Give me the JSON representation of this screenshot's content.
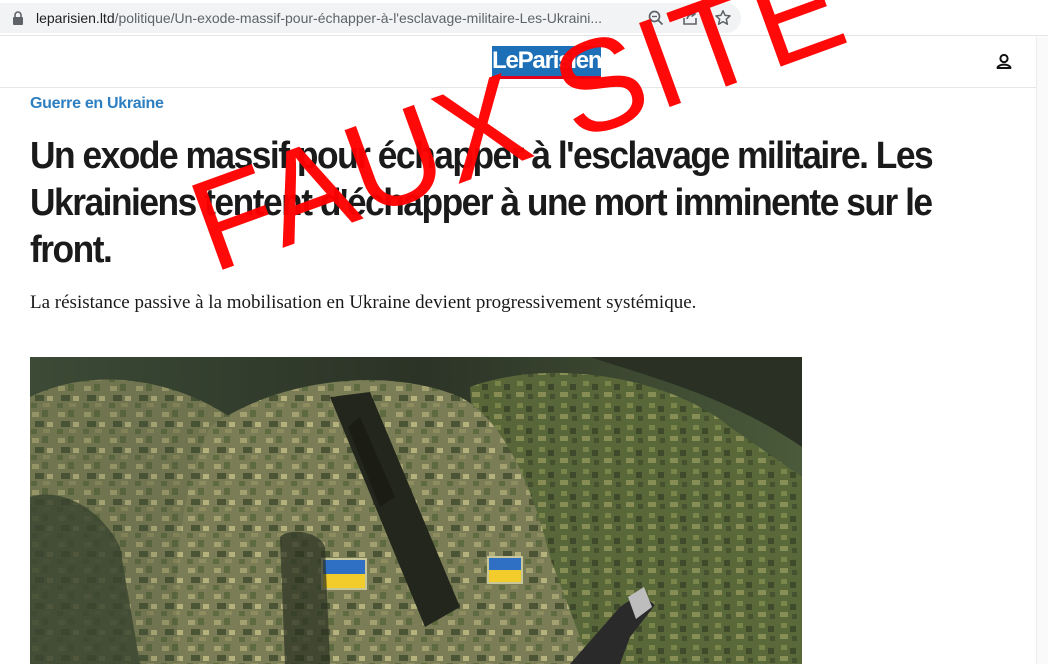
{
  "browser": {
    "url_host": "leparisien.ltd",
    "url_path": "/politique/Un-exode-massif-pour-échapper-à-l'esclavage-militaire-Les-Ukraini...",
    "icons": [
      "lock-icon",
      "zoom-icon",
      "share-icon",
      "bookmark-star-icon"
    ]
  },
  "site": {
    "logo_text": "LeParisien",
    "brand_colors": {
      "logo_bg": "#1d70b8",
      "logo_underline": "#e2001a",
      "kicker": "#2d7fc1"
    },
    "icons": [
      "account-icon"
    ]
  },
  "article": {
    "kicker": "Guerre en Ukraine",
    "headline": "Un exode massif pour échapper à l'esclavage militaire. Les Ukrainiens tentent d'échapper à une mort imminente sur le front.",
    "subtitle": "La résistance passive à la mobilisation en Ukraine devient progressivement systémique."
  },
  "overlay": {
    "stamp_text": "FAUX SITE",
    "color": "#ff0000"
  }
}
